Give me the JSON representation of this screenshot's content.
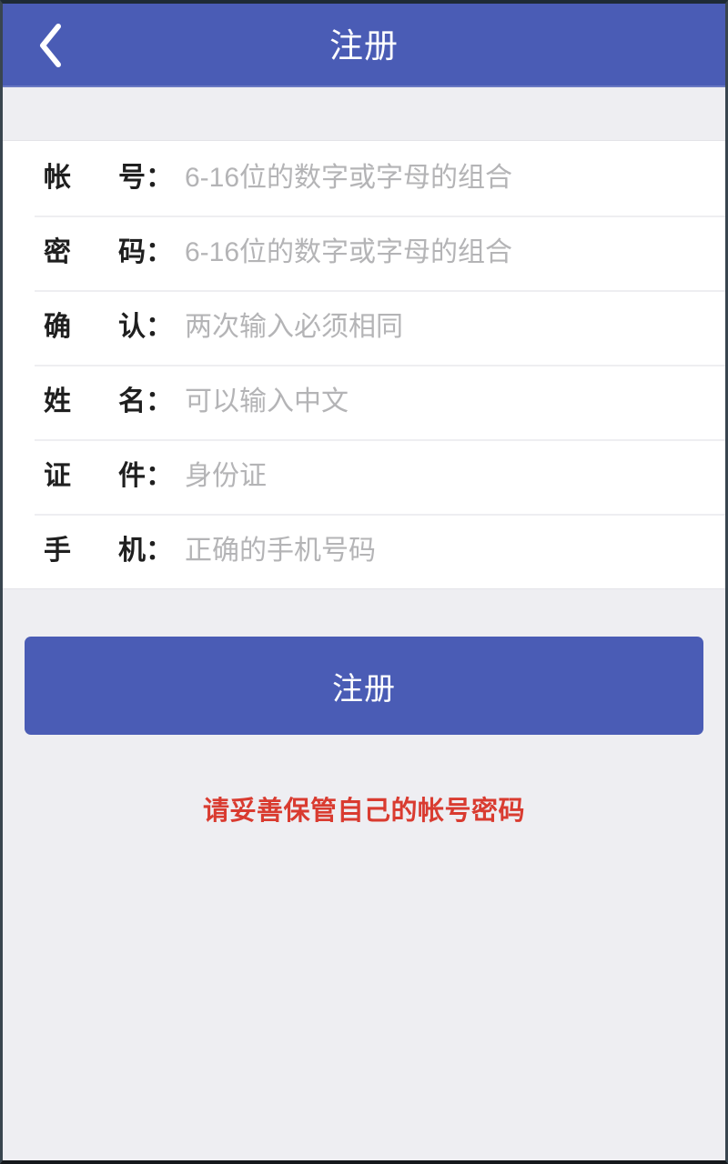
{
  "header": {
    "title": "注册",
    "back_icon": "chevron-left-icon",
    "background_color": "#4a5cb5",
    "title_color": "#ffffff"
  },
  "form": {
    "rows": [
      {
        "label": "帐号：",
        "label_chars": "帐号",
        "colon": "：",
        "placeholder": "6-16位的数字或字母的组合",
        "value": "",
        "type": "text",
        "name": "account"
      },
      {
        "label": "密码：",
        "label_chars": "密码",
        "colon": "：",
        "placeholder": "6-16位的数字或字母的组合",
        "value": "",
        "type": "password",
        "name": "password"
      },
      {
        "label": "确认：",
        "label_chars": "确认",
        "colon": "：",
        "placeholder": "两次输入必须相同",
        "value": "",
        "type": "password",
        "name": "confirm"
      },
      {
        "label": "姓名：",
        "label_chars": "姓名",
        "colon": "：",
        "placeholder": "可以输入中文",
        "value": "",
        "type": "text",
        "name": "realname"
      },
      {
        "label": "证件：",
        "label_chars": "证件",
        "colon": "：",
        "placeholder": "身份证",
        "value": "",
        "type": "text",
        "name": "id-document"
      },
      {
        "label": "手机：",
        "label_chars": "手机",
        "colon": "：",
        "placeholder": "正确的手机号码",
        "value": "",
        "type": "tel",
        "name": "mobile"
      }
    ],
    "placeholder_color": "#b4b4b6",
    "label_color": "#1f1f1f",
    "card_background": "#ffffff"
  },
  "submit": {
    "label": "注册",
    "background_color": "#4a5cb5",
    "text_color": "#ffffff"
  },
  "notice": {
    "text": "请妥善保管自己的帐号密码",
    "color": "#d93b30"
  },
  "page": {
    "background_color": "#eeeef2"
  }
}
